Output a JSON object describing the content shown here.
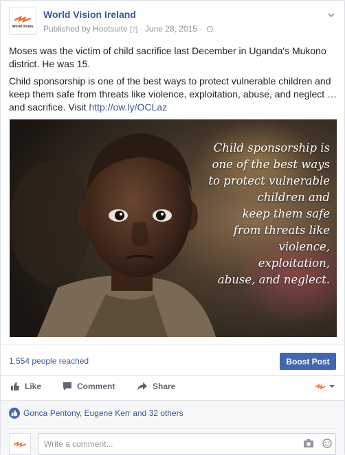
{
  "header": {
    "page_name": "World Vision Ireland",
    "published_by": "Published by Hootsuite",
    "help_marker": "[?]",
    "separator": "·",
    "date": "June 28, 2015",
    "logo_text": "World Vision"
  },
  "post": {
    "paragraph1": "Moses was the victim of child sacrifice last December in Uganda's Mukono district. He was 15.",
    "paragraph2_text": "Child sponsorship is one of the best ways to protect vulnerable children and keep them safe from threats like violence, exploitation, abuse, and neglect … and sacrifice. Visit ",
    "link": "http://ow.ly/OCLaz"
  },
  "image": {
    "overlay_lines": [
      "Child sponsorship is",
      "one of the best ways",
      "to protect vulnerable",
      "children and",
      "keep them safe",
      "from threats like",
      "violence, exploitation,",
      "abuse, and neglect."
    ]
  },
  "stats": {
    "reached": "1,554 people reached",
    "boost_label": "Boost Post"
  },
  "actions": {
    "like": "Like",
    "comment": "Comment",
    "share": "Share"
  },
  "reactions": {
    "likers": "Gonca Pentony, Eugene Kerr and 32 others"
  },
  "comment_box": {
    "placeholder": "Write a comment..."
  },
  "colors": {
    "link_blue": "#365899",
    "button_blue": "#4267b2",
    "brand_orange": "#f26522"
  },
  "icons": [
    "chevron-down-icon",
    "globe-icon",
    "like-icon",
    "comment-icon",
    "share-icon",
    "camera-icon",
    "emoji-icon"
  ]
}
